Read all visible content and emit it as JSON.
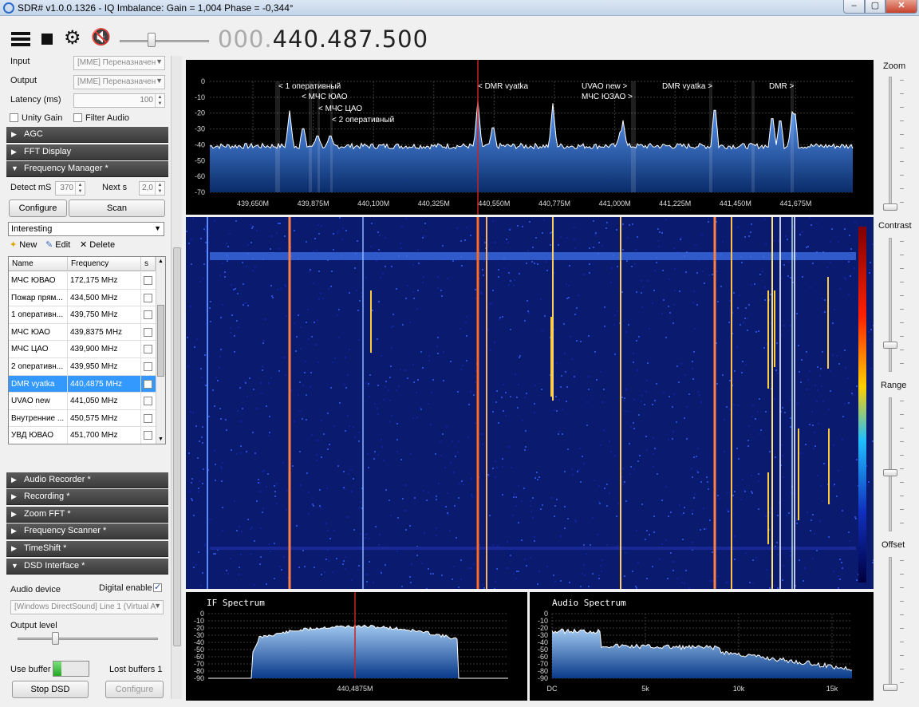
{
  "window": {
    "title": "SDR# v1.0.0.1326 - IQ Imbalance: Gain = 1,004 Phase = -0,344°",
    "min_label": "–",
    "max_label": "▢",
    "close_label": "✕"
  },
  "toolbar": {
    "freq_dim": "000.",
    "freq_main": "440.487.500"
  },
  "source": {
    "input_label": "Input",
    "input_value": "[MME] Переназначен",
    "output_label": "Output",
    "output_value": "[MME] Переназначен",
    "latency_label": "Latency (ms)",
    "latency_value": "100",
    "unity_gain_label": "Unity Gain",
    "filter_audio_label": "Filter Audio"
  },
  "panels": {
    "agc": "AGC",
    "fft": "FFT Display",
    "freq_manager": "Frequency Manager *",
    "audio_recorder": "Audio Recorder *",
    "recording": "Recording *",
    "zoom_fft": "Zoom FFT *",
    "freq_scanner": "Frequency Scanner *",
    "timeshift": "TimeShift *",
    "dsd": "DSD Interface *"
  },
  "freq_manager": {
    "detect_label": "Detect mS",
    "detect_value": "370",
    "next_label": "Next s",
    "next_value": "2,0",
    "configure_label": "Configure",
    "scan_label": "Scan",
    "group_value": "Interesting",
    "new_label": "New",
    "edit_label": "Edit",
    "delete_label": "Delete",
    "columns": {
      "name": "Name",
      "frequency": "Frequency",
      "s": "s"
    },
    "rows": [
      {
        "name": "МЧС ЮВАО",
        "freq": "172,175 MHz"
      },
      {
        "name": "Пожар прям...",
        "freq": "434,500 MHz"
      },
      {
        "name": "1 оперативн...",
        "freq": "439,750 MHz"
      },
      {
        "name": "МЧС ЮАО",
        "freq": "439,8375 MHz"
      },
      {
        "name": "МЧС ЦАО",
        "freq": "439,900 MHz"
      },
      {
        "name": "2 оперативн...",
        "freq": "439,950 MHz"
      },
      {
        "name": "DMR vyatka",
        "freq": "440,4875 MHz"
      },
      {
        "name": "UVAO new",
        "freq": "441,050 MHz"
      },
      {
        "name": "Внутренние ...",
        "freq": "450,575 MHz"
      },
      {
        "name": "УВД ЮВАО",
        "freq": "451,700 MHz"
      }
    ],
    "selected_row": 6
  },
  "dsd": {
    "audio_device_label": "Audio device",
    "digital_enable_label": "Digital enable",
    "device_value": "[Windows DirectSound] Line 1 (Virtual A",
    "output_level_label": "Output level",
    "use_buffer_label": "Use buffer",
    "lost_buffers_label": "Lost buffers 1",
    "stop_label": "Stop DSD",
    "configure_label": "Configure"
  },
  "right": {
    "zoom": "Zoom",
    "contrast": "Contrast",
    "range": "Range",
    "offset": "Offset"
  },
  "colors": {
    "spectrum_fill": "#2c6fd1",
    "accent_red": "#cc2222",
    "selection": "#3399ff"
  },
  "spectrum": {
    "db_ticks": [
      "0",
      "-10",
      "-20",
      "-30",
      "-40",
      "-50",
      "-60",
      "-70"
    ],
    "freq_ticks": [
      "439,650M",
      "439,875M",
      "440,100M",
      "440,325M",
      "440,550M",
      "440,775M",
      "441,000M",
      "441,225M",
      "441,450M",
      "441,675M"
    ],
    "labels": [
      "< 1 оперативный",
      "< МЧС ЮАО",
      "< МЧС ЦАО",
      "< 2 оперативный",
      "< DMR vyatka",
      "UVAO new >",
      "МЧС ЮЗАО >",
      "DMR vyatka >",
      "DMR >"
    ]
  },
  "if_spectrum": {
    "title": "IF Spectrum",
    "db_ticks": [
      "0",
      "-10",
      "-20",
      "-30",
      "-40",
      "-50",
      "-60",
      "-70",
      "-80",
      "-90"
    ],
    "center": "440,4875M"
  },
  "audio_spectrum": {
    "title": "Audio Spectrum",
    "db_ticks": [
      "0",
      "-10",
      "-20",
      "-30",
      "-40",
      "-50",
      "-60",
      "-70",
      "-80",
      "-90"
    ],
    "x_ticks": [
      "DC",
      "5k",
      "10k",
      "15k"
    ]
  }
}
